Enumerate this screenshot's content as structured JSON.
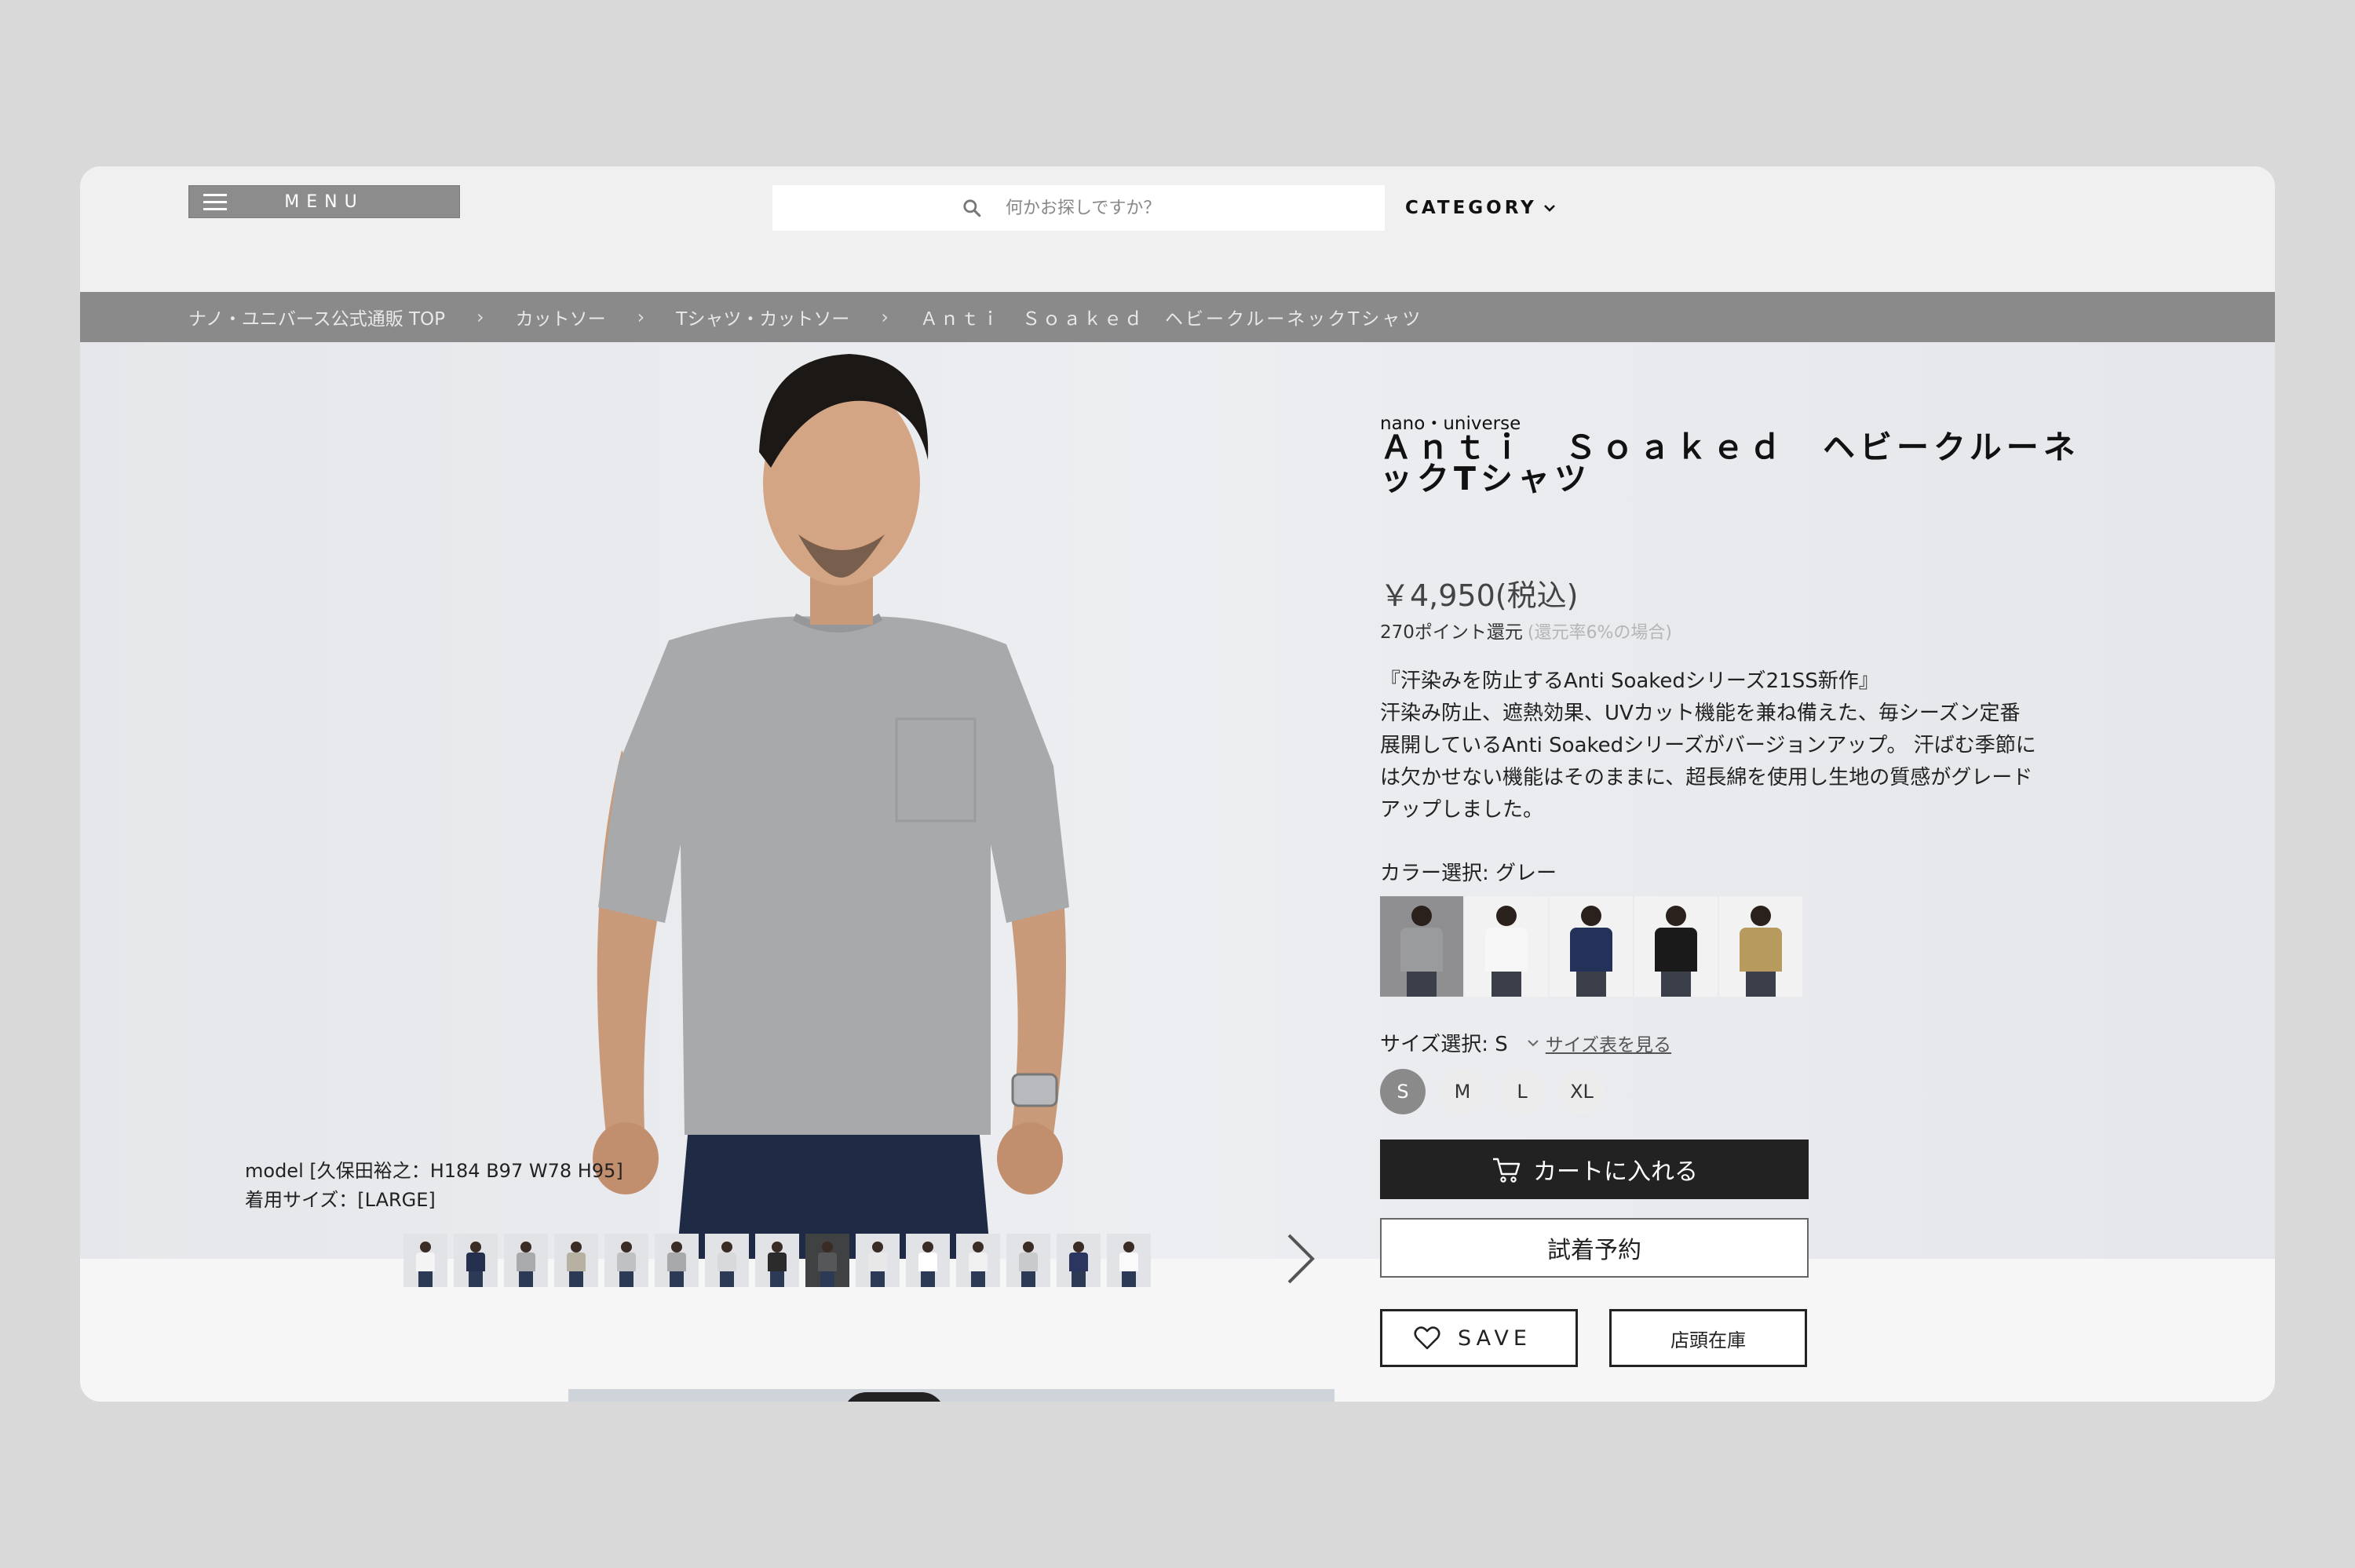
{
  "header": {
    "menu_label": "MENU",
    "search_placeholder": "何かお探しですか？",
    "category_label": "CATEGORY"
  },
  "breadcrumb": [
    "ナノ・ユニバース公式通販 TOP",
    "カットソー",
    "Tシャツ・カットソー",
    "Ａｎｔｉ　Ｓｏａｋｅｄ　ヘビークルーネックTシャツ"
  ],
  "gallery": {
    "caption_line1": "model [久保田裕之：H184 B97 W78 H95]",
    "caption_line2": "着用サイズ：[LARGE]",
    "thumbnails": [
      {
        "shirt": "#f4f4f4"
      },
      {
        "shirt": "#25304e"
      },
      {
        "shirt": "#a9aaab"
      },
      {
        "shirt": "#b7b1a2"
      },
      {
        "shirt": "#c0c1c2"
      },
      {
        "shirt": "#a7a9aa"
      },
      {
        "shirt": "#d8d9da"
      },
      {
        "shirt": "#2b2b2b"
      },
      {
        "shirt": "#555758",
        "dark": true
      },
      {
        "shirt": "#e8e8e8"
      },
      {
        "shirt": "#ffffff"
      },
      {
        "shirt": "#f0f0f0"
      },
      {
        "shirt": "#c9cacb"
      },
      {
        "shirt": "#2a3560"
      },
      {
        "shirt": "#fafafa"
      }
    ]
  },
  "product": {
    "brand": "nano・universe",
    "title": "Ａｎｔｉ　Ｓｏａｋｅｄ　ヘビークルーネックTシャツ",
    "price": "￥4,950(税込)",
    "points": "270ポイント還元",
    "points_note": "(還元率6%の場合)",
    "description": "『汗染みを防止するAnti Soakedシリーズ21SS新作』\n汗染み防止、遮熱効果、UVカット機能を兼ね備えた、毎シーズン定番展開しているAnti Soakedシリーズがバージョンアップ。 汗ばむ季節には欠かせない機能はそのままに、超長綿を使用し生地の質感がグレードアップしました。",
    "color_label": "カラー選択: グレー",
    "colors": [
      {
        "name": "グレー",
        "hex": "#9a9b9c",
        "selected": true
      },
      {
        "name": "ホワイト",
        "hex": "#f7f7f7",
        "selected": false
      },
      {
        "name": "ネイビー",
        "hex": "#243259",
        "selected": false
      },
      {
        "name": "ブラック",
        "hex": "#1a1a1a",
        "selected": false
      },
      {
        "name": "ベージュ",
        "hex": "#b69a5e",
        "selected": false
      }
    ],
    "size_label": "サイズ選択: S",
    "size_chart_link": "サイズ表を見る",
    "sizes": [
      {
        "label": "S",
        "selected": true
      },
      {
        "label": "M",
        "selected": false
      },
      {
        "label": "L",
        "selected": false
      },
      {
        "label": "XL",
        "selected": false
      }
    ],
    "cart_label": "カートに入れる",
    "reserve_label": "試着予約",
    "save_label": "SAVE",
    "store_stock_label": "店頭在庫"
  }
}
